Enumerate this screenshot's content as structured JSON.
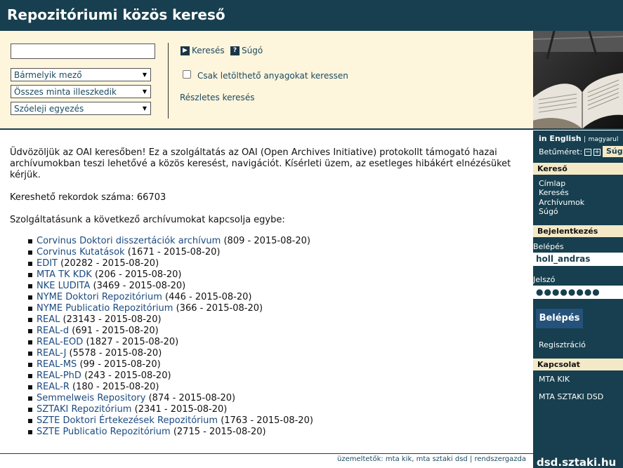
{
  "header": {
    "title": "Repozitóriumi közös kereső"
  },
  "search": {
    "query_value": "",
    "field_select": "Bármelyik mező",
    "match_select": "Összes minta illeszkedik",
    "mode_select": "Szóeleji egyezés",
    "search_button": "Keresés",
    "help_button": "Súgó",
    "downloadable_only_label": "Csak letölthető anyagokat keressen",
    "advanced_link": "Részletes keresés"
  },
  "main": {
    "intro": "Üdvözöljük az OAI keresőben! Ez a szolgáltatás az OAI (Open Archives Initiative) protokollt támogató hazai archívumokban teszi lehetővé a közös keresést, navigációt. Kísérleti üzem, az esetleges hibákért elnézésüket kérjük.",
    "record_count": "Kereshető rekordok száma: 66703",
    "lead": "Szolgáltatásunk a következő archívumokat kapcsolja egybe:",
    "archives": [
      {
        "name": "Corvinus Doktori disszertációk archívum",
        "info": "(809 - 2015-08-20)"
      },
      {
        "name": "Corvinus Kutatások",
        "info": "(1671 - 2015-08-20)"
      },
      {
        "name": "EDIT",
        "info": "(20282 - 2015-08-20)"
      },
      {
        "name": "MTA TK KDK",
        "info": "(206 - 2015-08-20)"
      },
      {
        "name": "NKE LUDITA",
        "info": "(3469 - 2015-08-20)"
      },
      {
        "name": "NYME Doktori Repozitórium",
        "info": "(446 - 2015-08-20)"
      },
      {
        "name": "NYME Publicatio Repozitórium",
        "info": "(366 - 2015-08-20)"
      },
      {
        "name": "REAL",
        "info": "(23143 - 2015-08-20)"
      },
      {
        "name": "REAL-d",
        "info": "(691 - 2015-08-20)"
      },
      {
        "name": "REAL-EOD",
        "info": "(1827 - 2015-08-20)"
      },
      {
        "name": "REAL-J",
        "info": "(5578 - 2015-08-20)"
      },
      {
        "name": "REAL-MS",
        "info": "(99 - 2015-08-20)"
      },
      {
        "name": "REAL-PhD",
        "info": "(243 - 2015-08-20)"
      },
      {
        "name": "REAL-R",
        "info": "(180 - 2015-08-20)"
      },
      {
        "name": "Semmelweis Repository",
        "info": "(874 - 2015-08-20)"
      },
      {
        "name": "SZTAKI Repozitórium",
        "info": "(2341 - 2015-08-20)"
      },
      {
        "name": "SZTE Doktori Értekezések Repozitórium",
        "info": "(1763 - 2015-08-20)"
      },
      {
        "name": "SZTE Publicatio Repozitórium",
        "info": "(2715 - 2015-08-20)"
      }
    ]
  },
  "footer": {
    "prefix": "üzemeltetők:",
    "op1": "mta kik",
    "op2": "mta sztaki dsd",
    "sep": "|",
    "admin": "rendszergazda"
  },
  "sidebar": {
    "lang_english": "in English",
    "lang_sep": "|",
    "lang_hungarian": "magyarul",
    "font_size_label": "Betűméret:",
    "font_minus": "−",
    "font_plus": "+",
    "help_button": "Súgó",
    "search_section": "Kereső",
    "search_links": [
      "Címlap",
      "Keresés",
      "Archívumok",
      "Súgó"
    ],
    "login_section": "Bejelentkezés",
    "login_label": "Belépés",
    "login_value": "holl_andras",
    "password_label": "Jelszó",
    "password_value": "●●●●●●●●",
    "login_button": "Belépés",
    "register_link": "Regisztráció",
    "contact_section": "Kapcsolat",
    "contact_links": [
      "MTA KIK",
      "MTA SZTAKI DSD"
    ],
    "domain": "dsd.sztaki.hu"
  }
}
